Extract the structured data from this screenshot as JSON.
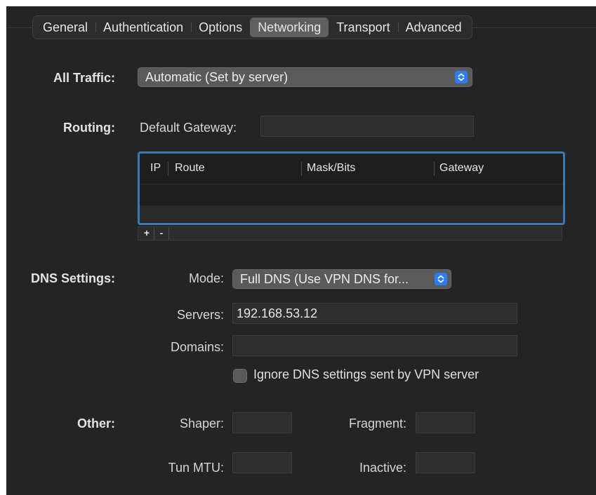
{
  "tabs": [
    "General",
    "Authentication",
    "Options",
    "Networking",
    "Transport",
    "Advanced"
  ],
  "active_tab": "Networking",
  "all_traffic": {
    "label": "All Traffic:",
    "value": "Automatic (Set by server)"
  },
  "routing": {
    "label": "Routing:",
    "default_gateway_label": "Default Gateway:",
    "default_gateway_value": "",
    "columns": [
      "IP",
      "Route",
      "Mask/Bits",
      "Gateway"
    ],
    "rows": [],
    "add_label": "+",
    "remove_label": "-"
  },
  "dns": {
    "label": "DNS Settings:",
    "mode_label": "Mode:",
    "mode_value": "Full DNS (Use VPN DNS for...",
    "servers_label": "Servers:",
    "servers_value": "192.168.53.12",
    "domains_label": "Domains:",
    "domains_value": "",
    "ignore_label": "Ignore DNS settings sent by VPN server",
    "ignore_checked": false
  },
  "other": {
    "label": "Other:",
    "shaper_label": "Shaper:",
    "shaper_value": "",
    "fragment_label": "Fragment:",
    "fragment_value": "",
    "tun_mtu_label": "Tun MTU:",
    "tun_mtu_value": "",
    "inactive_label": "Inactive:",
    "inactive_value": ""
  },
  "colors": {
    "background": "#242424",
    "accent": "#2d7cf6",
    "focus_ring": "#3a78b7"
  }
}
